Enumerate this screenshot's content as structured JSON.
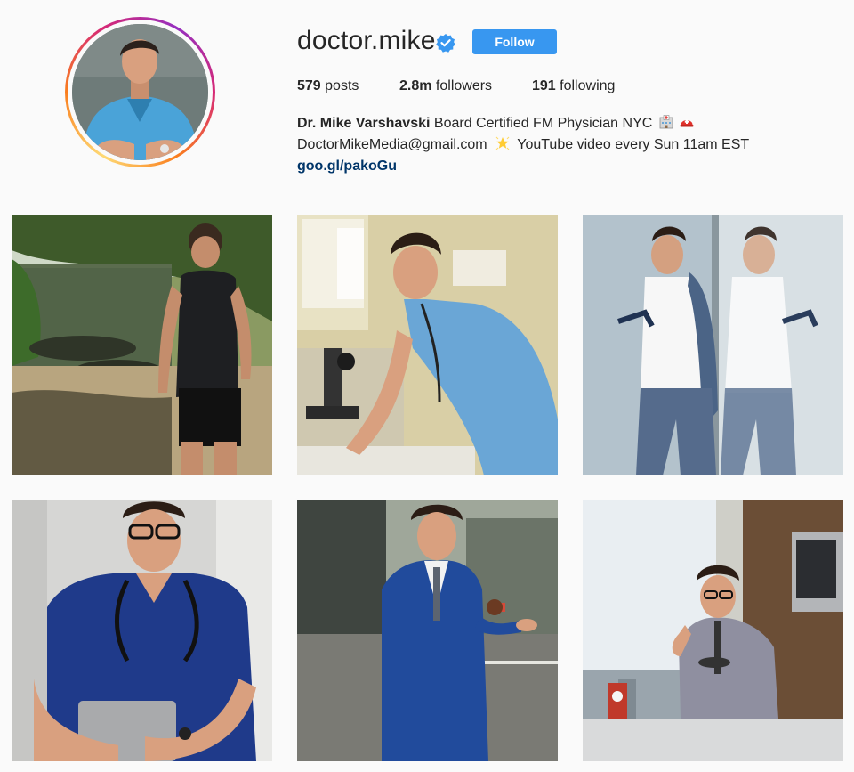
{
  "profile": {
    "username": "doctor.mike",
    "verified": true,
    "follow_label": "Follow",
    "stats": {
      "posts_count": "579",
      "posts_label": "posts",
      "followers_count": "2.8m",
      "followers_label": "followers",
      "following_count": "191",
      "following_label": "following"
    },
    "bio": {
      "name": "Dr. Mike Varshavski",
      "line1": "Board Certified FM Physician NYC",
      "line2_email": "DoctorMikeMedia@gmail.com",
      "line2_text": "YouTube video every Sun 11am EST",
      "link": "goo.gl/pakoGu"
    }
  },
  "icons": {
    "verified": "verified-badge-icon",
    "hospital": "hospital-icon",
    "helmet": "rescue-helmet-icon",
    "star": "glowing-star-icon"
  },
  "colors": {
    "follow_button": "#3897f0",
    "verified_badge": "#3897f0",
    "link": "#003569",
    "background": "#fafafa",
    "text": "#262626"
  },
  "posts": [
    {
      "alt": "Man in black tank top by swamp with alligators"
    },
    {
      "alt": "Doctor in blue scrubs leaning on lab counter with microscope"
    },
    {
      "alt": "Man in white shirt and plaid trousers next to mirror"
    },
    {
      "alt": "Doctor in navy scrubs with stethoscope holding laptop"
    },
    {
      "alt": "Man in blue suit tossing a ball on the street"
    },
    {
      "alt": "Man in kitchen eating cereal by the window"
    }
  ]
}
